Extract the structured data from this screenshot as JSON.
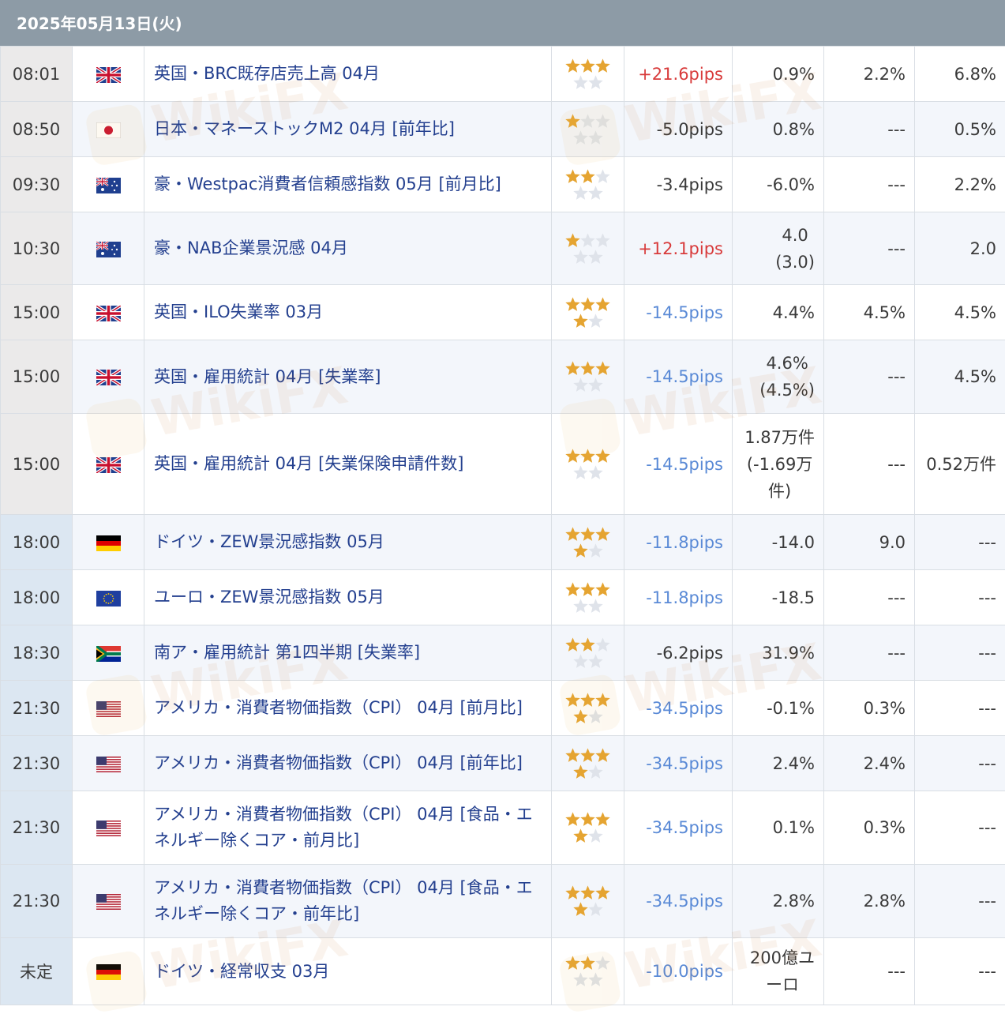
{
  "header": {
    "date": "2025年05月13日(火)"
  },
  "colors": {
    "up": "#d83b3b",
    "down": "#5a8ad6",
    "star_on": "#e5a431",
    "star_off": "#dfe3ea"
  },
  "watermark": {
    "text": "WikiFX"
  },
  "rows": [
    {
      "time": "08:01",
      "group": "a",
      "flag": "uk-flag-icon",
      "event": "英国・BRC既存店売上高 04月",
      "stars": 3,
      "pips": "+21.6pips",
      "pips_dir": "up",
      "actual": [
        "0.9%"
      ],
      "forecast": "2.2%",
      "previous": "6.8%"
    },
    {
      "time": "08:50",
      "group": "a",
      "flag": "japan-flag-icon",
      "event": "日本・マネーストックM2 04月 [前年比]",
      "stars": 1,
      "pips": "-5.0pips",
      "pips_dir": "neutral",
      "actual": [
        "0.8%"
      ],
      "forecast": "---",
      "previous": "0.5%"
    },
    {
      "time": "09:30",
      "group": "a",
      "flag": "australia-flag-icon",
      "event": "豪・Westpac消費者信頼感指数 05月 [前月比]",
      "stars": 2,
      "pips": "-3.4pips",
      "pips_dir": "neutral",
      "actual": [
        "-6.0%"
      ],
      "forecast": "---",
      "previous": "2.2%"
    },
    {
      "time": "10:30",
      "group": "a",
      "flag": "australia-flag-icon",
      "event": "豪・NAB企業景況感 04月",
      "stars": 1,
      "pips": "+12.1pips",
      "pips_dir": "up",
      "actual": [
        "4.0",
        "(3.0)"
      ],
      "forecast": "---",
      "previous": "2.0"
    },
    {
      "time": "15:00",
      "group": "a",
      "flag": "uk-flag-icon",
      "event": "英国・ILO失業率 03月",
      "stars": 4,
      "pips": "-14.5pips",
      "pips_dir": "down",
      "actual": [
        "4.4%"
      ],
      "forecast": "4.5%",
      "previous": "4.5%"
    },
    {
      "time": "15:00",
      "group": "a",
      "flag": "uk-flag-icon",
      "event": "英国・雇用統計 04月 [失業率]",
      "stars": 3,
      "pips": "-14.5pips",
      "pips_dir": "down",
      "actual": [
        "4.6%",
        "(4.5%)"
      ],
      "forecast": "---",
      "previous": "4.5%"
    },
    {
      "time": "15:00",
      "group": "a",
      "flag": "uk-flag-icon",
      "event": "英国・雇用統計 04月 [失業保険申請件数]",
      "stars": 3,
      "pips": "-14.5pips",
      "pips_dir": "down",
      "actual": [
        "1.87万件",
        "(-1.69万",
        "件)"
      ],
      "forecast": "---",
      "previous": "0.52万件"
    },
    {
      "time": "18:00",
      "group": "b",
      "flag": "germany-flag-icon",
      "event": "ドイツ・ZEW景況感指数 05月",
      "stars": 4,
      "pips": "-11.8pips",
      "pips_dir": "down",
      "actual": [
        "-14.0"
      ],
      "forecast": "9.0",
      "previous": "---"
    },
    {
      "time": "18:00",
      "group": "b",
      "flag": "eu-flag-icon",
      "event": "ユーロ・ZEW景況感指数 05月",
      "stars": 3,
      "pips": "-11.8pips",
      "pips_dir": "down",
      "actual": [
        "-18.5"
      ],
      "forecast": "---",
      "previous": "---"
    },
    {
      "time": "18:30",
      "group": "b",
      "flag": "south-africa-flag-icon",
      "event": "南ア・雇用統計 第1四半期 [失業率]",
      "stars": 2,
      "pips": "-6.2pips",
      "pips_dir": "neutral",
      "actual": [
        "31.9%"
      ],
      "forecast": "---",
      "previous": "---"
    },
    {
      "time": "21:30",
      "group": "b",
      "flag": "us-flag-icon",
      "event": "アメリカ・消費者物価指数（CPI） 04月 [前月比]",
      "stars": 4,
      "pips": "-34.5pips",
      "pips_dir": "down",
      "actual": [
        "-0.1%"
      ],
      "forecast": "0.3%",
      "previous": "---"
    },
    {
      "time": "21:30",
      "group": "b",
      "flag": "us-flag-icon",
      "event": "アメリカ・消費者物価指数（CPI） 04月 [前年比]",
      "stars": 4,
      "pips": "-34.5pips",
      "pips_dir": "down",
      "actual": [
        "2.4%"
      ],
      "forecast": "2.4%",
      "previous": "---"
    },
    {
      "time": "21:30",
      "group": "b",
      "flag": "us-flag-icon",
      "event": "アメリカ・消費者物価指数（CPI） 04月 [食品・エネルギー除くコア・前月比]",
      "stars": 4,
      "pips": "-34.5pips",
      "pips_dir": "down",
      "actual": [
        "0.1%"
      ],
      "forecast": "0.3%",
      "previous": "---"
    },
    {
      "time": "21:30",
      "group": "b",
      "flag": "us-flag-icon",
      "event": "アメリカ・消費者物価指数（CPI） 04月 [食品・エネルギー除くコア・前年比]",
      "stars": 4,
      "pips": "-34.5pips",
      "pips_dir": "down",
      "actual": [
        "2.8%"
      ],
      "forecast": "2.8%",
      "previous": "---"
    },
    {
      "time": "未定",
      "group": "b",
      "flag": "germany-flag-icon",
      "event": "ドイツ・経常収支 03月",
      "stars": 2,
      "pips": "-10.0pips",
      "pips_dir": "down",
      "actual": [
        "200億ユ",
        "ーロ"
      ],
      "forecast": "---",
      "previous": "---"
    }
  ]
}
